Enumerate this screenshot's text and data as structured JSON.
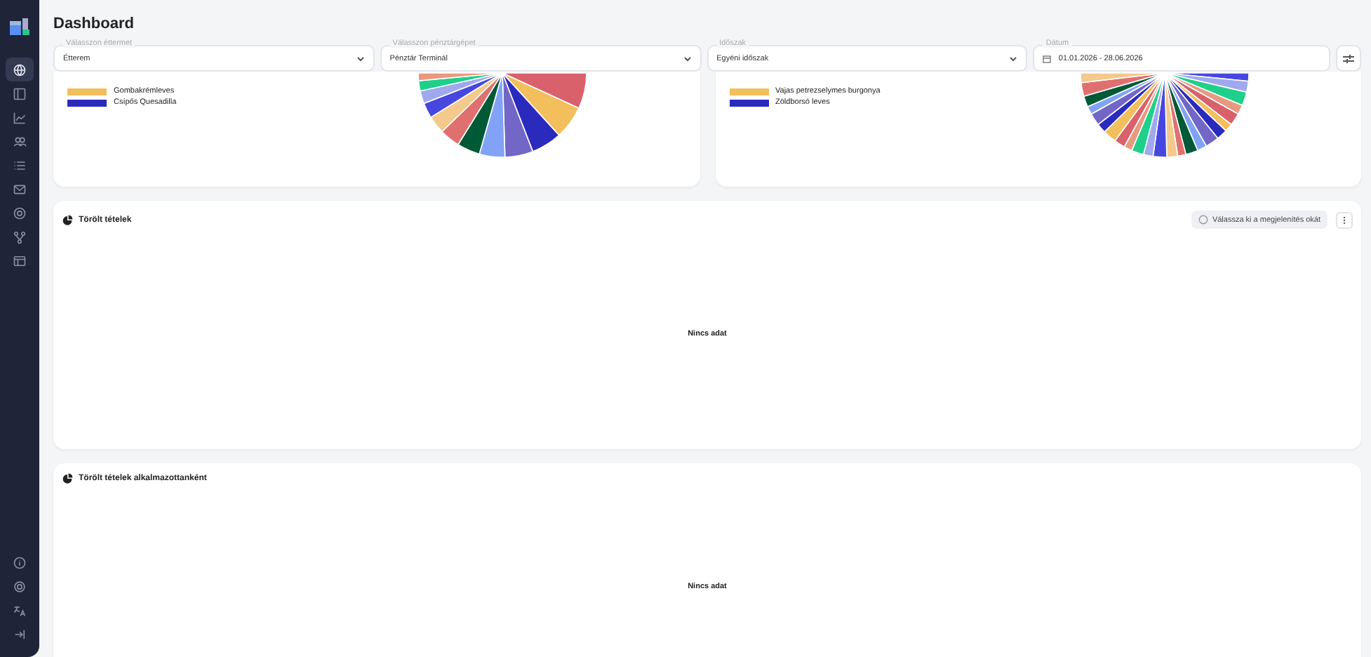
{
  "page": {
    "title": "Dashboard"
  },
  "filters": [
    {
      "label": "Válasszon éttermet",
      "value": "Étterem",
      "kind": "select"
    },
    {
      "label": "Válasszon pénztárgépet",
      "value": "Pénztár Terminál",
      "kind": "select"
    },
    {
      "label": "Időszak",
      "value": "Egyéni időszak",
      "kind": "select"
    },
    {
      "label": "Dátum",
      "value": "01.01.2026 - 28.06.2026",
      "kind": "date"
    }
  ],
  "sidebar": {
    "items": [
      {
        "selected": true
      },
      {
        "selected": false
      },
      {
        "selected": false
      },
      {
        "selected": false
      },
      {
        "selected": false
      },
      {
        "selected": false
      },
      {
        "selected": false
      },
      {
        "selected": false
      },
      {
        "selected": false
      }
    ]
  },
  "pie_cards": [
    {
      "legend": [
        {
          "label": "Gombakrémleves",
          "color": "#f2bf5c"
        },
        {
          "label": "Csípős Quesadilla",
          "color": "#2a2bbd"
        }
      ]
    },
    {
      "legend": [
        {
          "label": "Vajas petrezselymes burgonya",
          "color": "#f2bf5c"
        },
        {
          "label": "Zöldborsó leves",
          "color": "#2a2bbd"
        }
      ]
    }
  ],
  "panels": [
    {
      "title": "Törölt tételek",
      "empty_text": "Nincs adat",
      "hint": "Válassza ki a megjelenítés okát"
    },
    {
      "title": "Törölt tételek alkalmazottanként",
      "empty_text": "Nincs adat"
    }
  ]
}
